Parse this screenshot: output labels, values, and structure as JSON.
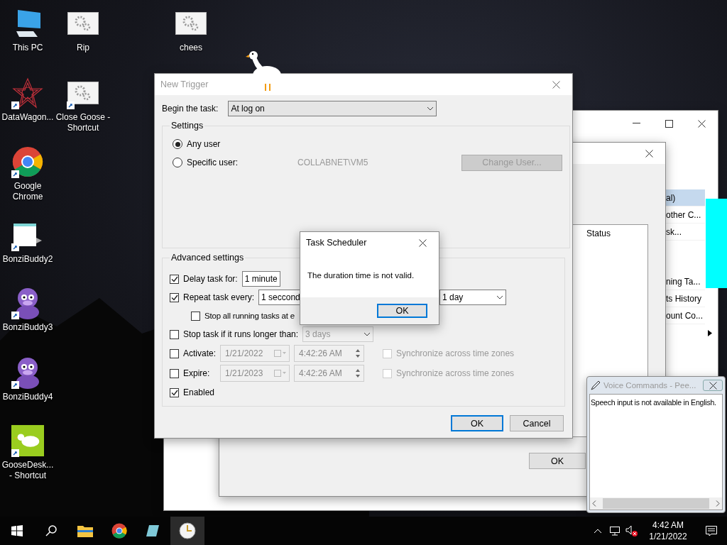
{
  "desktop_icons": [
    {
      "label": "This PC",
      "kind": "computer",
      "shortcut": false
    },
    {
      "label": "Rip",
      "kind": "gear",
      "shortcut": false
    },
    {
      "label": "chees",
      "kind": "gear",
      "shortcut": false
    },
    {
      "label": "DataWagon...",
      "kind": "star",
      "shortcut": true
    },
    {
      "label": "Close Goose - Shortcut",
      "kind": "gear",
      "shortcut": true
    },
    {
      "label": "Google Chrome",
      "kind": "chrome",
      "shortcut": true
    },
    {
      "label": "BonziBuddy2",
      "kind": "window",
      "shortcut": true
    },
    {
      "label": "BonziBuddy3",
      "kind": "bonzi",
      "shortcut": true
    },
    {
      "label": "BonziBuddy4",
      "kind": "bonzi",
      "shortcut": true
    },
    {
      "label": "GooseDesk... - Shortcut",
      "kind": "goose",
      "shortcut": true
    }
  ],
  "scheduler_window": {
    "action_groups": [
      [
        {
          "label": "al)",
          "selected": true
        },
        {
          "label": "other C...",
          "selected": false
        },
        {
          "label": "sk...",
          "selected": false
        }
      ],
      [
        {
          "label": "ning Ta...",
          "selected": false
        },
        {
          "label": "ts History",
          "selected": false
        },
        {
          "label": "ount Co...",
          "selected": false
        }
      ]
    ]
  },
  "create_task_window": {
    "status_column": "Status",
    "ok_button": "OK"
  },
  "new_trigger": {
    "title": "New Trigger",
    "begin_label": "Begin the task:",
    "begin_value": "At log on",
    "settings_title": "Settings",
    "users": [
      {
        "label": "Any user",
        "selected": true
      },
      {
        "label": "Specific user:",
        "selected": false
      }
    ],
    "user_name": "COLLABNET\\VM5",
    "change_user_button": {
      "label": "Change User...",
      "disabled": true
    },
    "advanced_title": "Advanced settings",
    "advanced_rows": [
      {
        "kind": "dropdown",
        "label": "Delay task for:",
        "checked": true,
        "value": "1 minute"
      },
      {
        "kind": "repeat",
        "label": "Repeat task every:",
        "checked": true,
        "value": "1 seccond",
        "duration_value": "1 day"
      },
      {
        "kind": "sub_check",
        "label": "Stop all running tasks at e",
        "checked": false
      },
      {
        "kind": "dropdown",
        "label": "Stop task if it runs longer than:",
        "checked": false,
        "value": "3 days"
      },
      {
        "kind": "date",
        "label": "Activate:",
        "checked": false,
        "date": "1/21/2022",
        "time": "4:42:26 AM",
        "sync_label": "Synchronize across time zones",
        "sync_checked": false
      },
      {
        "kind": "date",
        "label": "Expire:",
        "checked": false,
        "date": "1/21/2023",
        "time": "4:42:26 AM",
        "sync_label": "Synchronize across time zones",
        "sync_checked": false
      },
      {
        "kind": "check",
        "label": "Enabled",
        "checked": true
      }
    ],
    "buttons": [
      "OK",
      "Cancel"
    ]
  },
  "message_box": {
    "title": "Task Scheduler",
    "message": "The duration time is not valid.",
    "button": "OK"
  },
  "voice_commands": {
    "title": "Voice Commands - Pee...",
    "message": "Speech input is not available in English."
  },
  "taskbar": {
    "time": "4:42 AM",
    "date": "1/21/2022"
  }
}
